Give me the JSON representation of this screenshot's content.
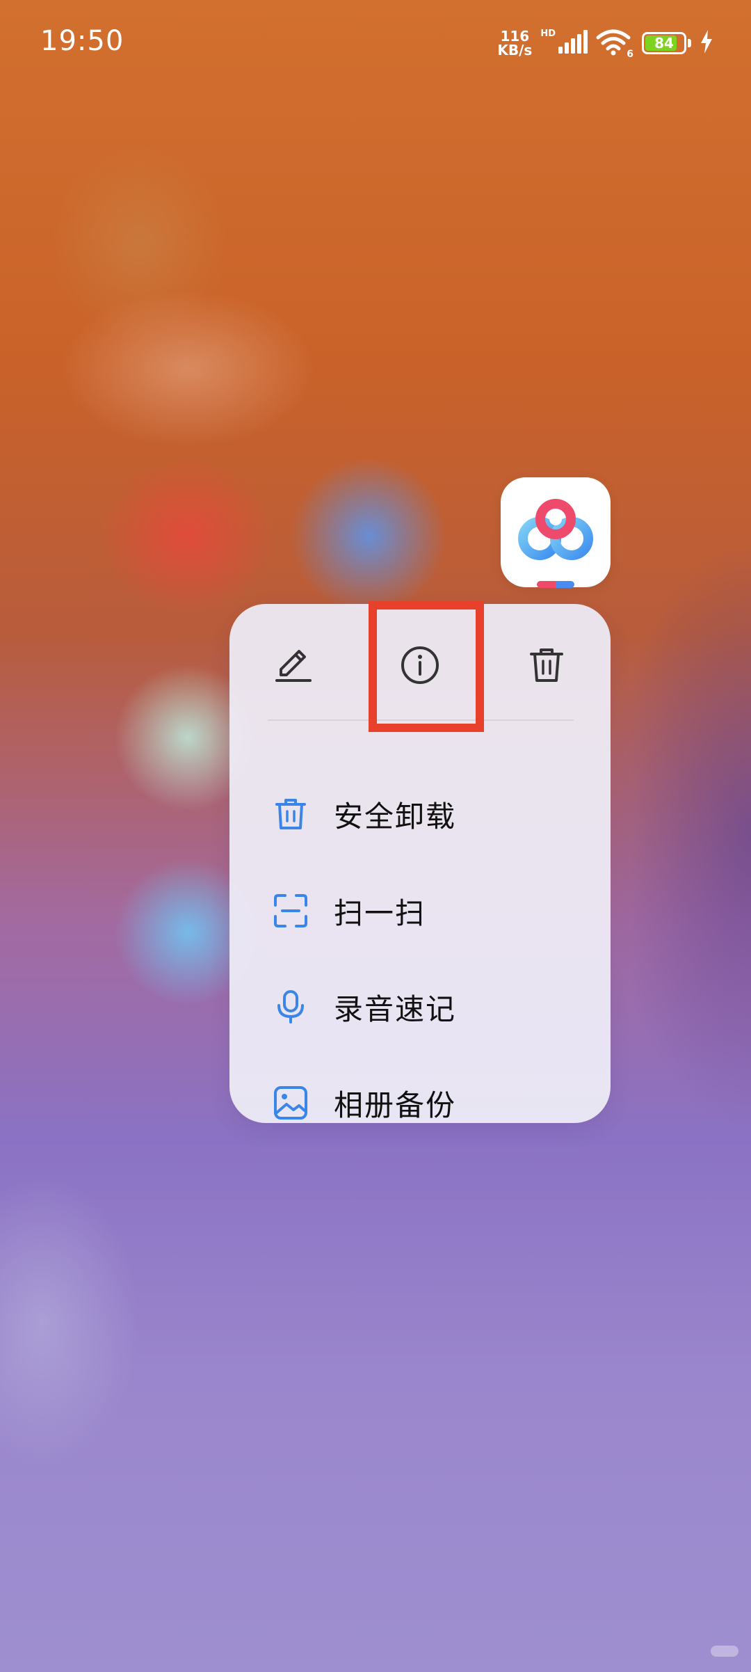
{
  "status_bar": {
    "time": "19:50",
    "net_speed_value": "116",
    "net_speed_unit": "KB/s",
    "hd_label": "HD",
    "wifi_badge": "6",
    "battery_level": "84",
    "battery_fraction": 0.84
  },
  "top_actions": [
    {
      "icon": "pencil-icon",
      "name": "edit"
    },
    {
      "icon": "info-icon",
      "name": "info"
    },
    {
      "icon": "trash-icon",
      "name": "delete"
    }
  ],
  "menu": {
    "items": [
      {
        "label": "安全卸载",
        "icon": "trash-icon"
      },
      {
        "label": "扫一扫",
        "icon": "scan-icon"
      },
      {
        "label": "录音速记",
        "icon": "microphone-icon"
      },
      {
        "label": "相册备份",
        "icon": "image-icon"
      }
    ]
  },
  "colors": {
    "accent_blue": "#3a86e8",
    "highlight_red": "#e8412b",
    "battery_green": "#7ed321"
  }
}
